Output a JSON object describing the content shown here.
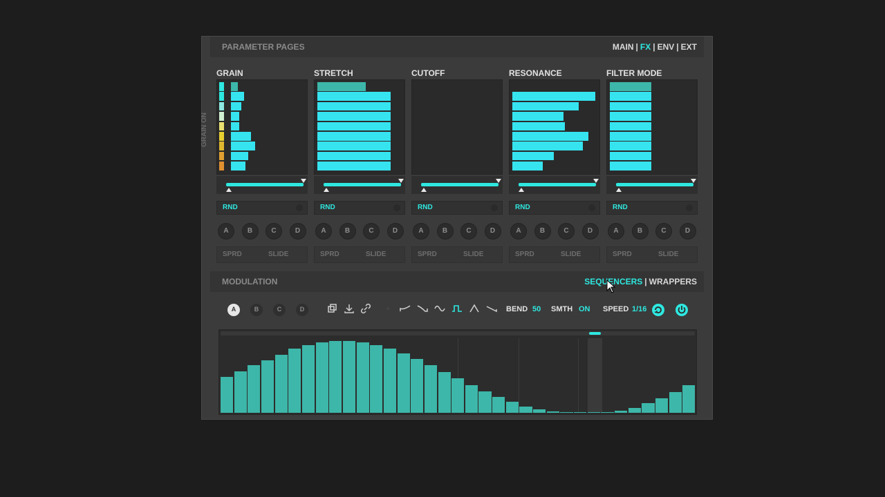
{
  "header": {
    "title": "PARAMETER PAGES",
    "pages": [
      "MAIN",
      "FX",
      "ENV",
      "EXT"
    ],
    "active_page": "FX"
  },
  "grain_on_label": "GRAIN ON",
  "columns": [
    {
      "title": "GRAIN",
      "bars": [
        0.1,
        0.18,
        0.14,
        0.12,
        0.12,
        0.28,
        0.34,
        0.24,
        0.2
      ],
      "rnd": "RND",
      "buttons": [
        "A",
        "B",
        "C",
        "D"
      ],
      "sprd": "SPRD",
      "slide": "SLIDE"
    },
    {
      "title": "STRETCH",
      "bars": [
        0.58,
        0.88,
        0.88,
        0.88,
        0.88,
        0.88,
        0.88,
        0.88,
        0.88
      ],
      "rnd": "RND",
      "buttons": [
        "A",
        "B",
        "C",
        "D"
      ],
      "sprd": "SPRD",
      "slide": "SLIDE"
    },
    {
      "title": "CUTOFF",
      "bars": [
        0,
        0,
        0,
        0,
        0,
        0,
        0,
        0,
        0
      ],
      "rnd": "RND",
      "buttons": [
        "A",
        "B",
        "C",
        "D"
      ],
      "sprd": "SPRD",
      "slide": "SLIDE"
    },
    {
      "title": "RESONANCE",
      "bars": [
        0,
        1.0,
        0.8,
        0.62,
        0.63,
        0.92,
        0.85,
        0.5,
        0.37
      ],
      "rnd": "RND",
      "buttons": [
        "A",
        "B",
        "C",
        "D"
      ],
      "sprd": "SPRD",
      "slide": "SLIDE"
    },
    {
      "title": "FILTER MODE",
      "bars": [
        0.5,
        0.5,
        0.5,
        0.5,
        0.5,
        0.5,
        0.5,
        0.5,
        0.5
      ],
      "rnd": "RND",
      "buttons": [
        "A",
        "B",
        "C",
        "D"
      ],
      "sprd": "SPRD",
      "slide": "SLIDE"
    }
  ],
  "modulation": {
    "title": "MODULATION",
    "tabs": [
      "SEQUENCERS",
      "WRAPPERS"
    ],
    "active_tab": "SEQUENCERS"
  },
  "toolbar": {
    "lanes": [
      "A",
      "B",
      "C",
      "D"
    ],
    "active_lane": "A",
    "bend_label": "BEND",
    "bend_value": "50",
    "smth_label": "SMTH",
    "smth_value": "ON",
    "speed_label": "SPEED",
    "speed_value": "1/16"
  },
  "colors": {
    "accent": "#2ee8e0",
    "seq_bar": "#3db7a9",
    "grain_orange": "#e0a030",
    "grain_yellow": "#e8d030"
  },
  "sequencer": {
    "values": [
      0.5,
      0.58,
      0.66,
      0.73,
      0.81,
      0.89,
      0.94,
      0.98,
      1.0,
      1.0,
      0.98,
      0.94,
      0.89,
      0.83,
      0.75,
      0.66,
      0.57,
      0.48,
      0.38,
      0.3,
      0.22,
      0.15,
      0.09,
      0.05,
      0.02,
      0.01,
      0.0,
      0.0,
      0.01,
      0.03,
      0.07,
      0.13,
      0.2,
      0.29,
      0.38
    ],
    "playhead_step": 27
  }
}
